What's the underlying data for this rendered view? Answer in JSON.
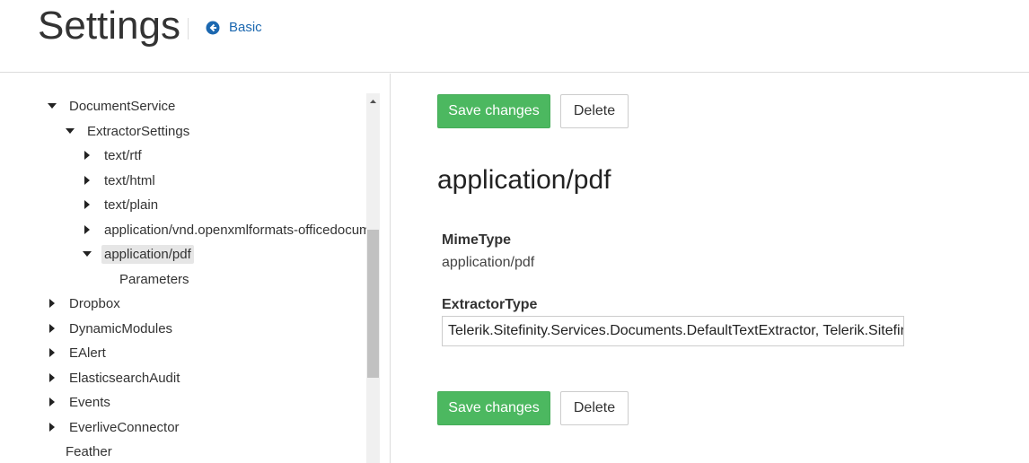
{
  "header": {
    "title": "Settings",
    "back_link_label": "Basic"
  },
  "tree": {
    "items": [
      {
        "label": "DocumentService",
        "expanded": true
      },
      {
        "label": "ExtractorSettings",
        "expanded": true
      },
      {
        "label": "text/rtf",
        "expanded": false
      },
      {
        "label": "text/html",
        "expanded": false
      },
      {
        "label": "text/plain",
        "expanded": false
      },
      {
        "label": "application/vnd.openxmlformats-officedocument",
        "expanded": false
      },
      {
        "label": "application/pdf",
        "expanded": true,
        "selected": true
      },
      {
        "label": "Parameters"
      },
      {
        "label": "Dropbox",
        "expanded": false
      },
      {
        "label": "DynamicModules",
        "expanded": false
      },
      {
        "label": "EAlert",
        "expanded": false
      },
      {
        "label": "ElasticsearchAudit",
        "expanded": false
      },
      {
        "label": "Events",
        "expanded": false
      },
      {
        "label": "EverliveConnector",
        "expanded": false
      },
      {
        "label": "Feather"
      }
    ]
  },
  "toolbar": {
    "save_label": "Save changes",
    "delete_label": "Delete"
  },
  "detail": {
    "title": "application/pdf",
    "mime_label": "MimeType",
    "mime_value": "application/pdf",
    "extractor_label": "ExtractorType",
    "extractor_value": "Telerik.Sitefinity.Services.Documents.DefaultTextExtractor, Telerik.Sitefinity"
  },
  "colors": {
    "save_button": "#4cb860",
    "link": "#1c68b0"
  }
}
